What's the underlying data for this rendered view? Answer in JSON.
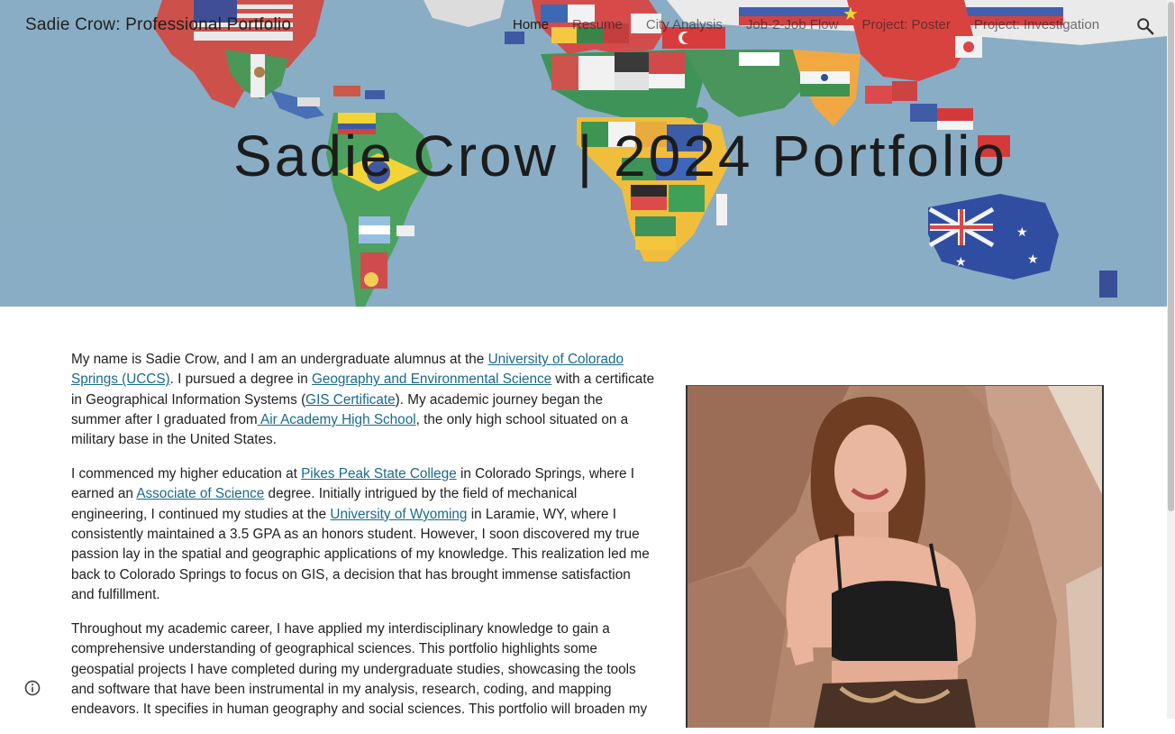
{
  "header": {
    "site_title": "Sadie Crow: Professional Portfolio",
    "nav": [
      {
        "label": "Home",
        "active": true
      },
      {
        "label": "Resume",
        "active": false
      },
      {
        "label": "City Analysis",
        "active": false
      },
      {
        "label": "Job-2-Job Flow",
        "active": false
      },
      {
        "label": "Project: Poster",
        "active": false
      },
      {
        "label": "Project: Investigation",
        "active": false
      }
    ],
    "search_icon": "search-icon"
  },
  "hero": {
    "title": "Sadie Crow | 2024 Portfolio",
    "background": "world-map-of-flags"
  },
  "body": {
    "p1": {
      "t1": "My name is Sadie Crow, and I am an undergraduate alumnus at the ",
      "l1": "University of Colorado Springs (UCCS)",
      "t2": ". I pursued a degree in ",
      "l2": "Geography and Environmental Science",
      "t3": " with a certificate in Geographical Information Systems (",
      "l3": "GIS Certificate",
      "t4": "). My academic journey began the summer after I graduated from",
      "l4": " Air Academy High School",
      "t5": ", the only high school situated on a military base in the United States."
    },
    "p2": {
      "t1": "I commenced my higher education at ",
      "l1": "Pikes Peak State College",
      "t2": " in Colorado Springs, where I earned an ",
      "l2": "Associate of Science",
      "t3": " degree. Initially intrigued by the field of mechanical engineering, I continued my studies at the ",
      "l3": "University of Wyoming",
      "t4": " in Laramie, WY, where I consistently maintained a 3.5 GPA as an honors student. However, I soon discovered my true passion lay in the spatial and geographic applications of my knowledge. This realization led me back to Colorado Springs to focus on GIS, a decision that has brought immense satisfaction and fulfillment."
    },
    "p3": {
      "t1": "Throughout my academic career, I have applied my interdisciplinary knowledge to gain a comprehensive understanding of geographical sciences. This portfolio highlights some geospatial projects I have completed during my undergraduate studies, showcasing the tools and software that have been instrumental in my analysis, research, coding, and mapping endeavors. It specifies in human geography and social sciences. This portfolio will broaden my"
    }
  },
  "colors": {
    "link": "#1a6a8a",
    "ocean": "#7fa7bf"
  },
  "footer": {
    "info_icon": "info-icon"
  }
}
